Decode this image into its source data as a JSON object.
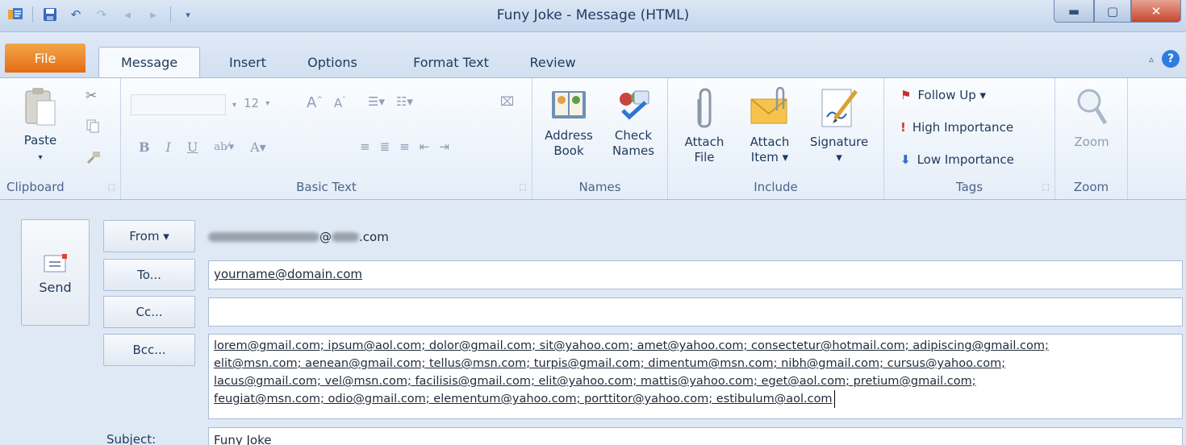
{
  "window": {
    "title": "Funy Joke  -  Message (HTML)",
    "quick_access": [
      "outlook-icon",
      "save-icon",
      "undo-icon",
      "redo-icon",
      "previous-icon",
      "next-icon",
      "customize-icon"
    ]
  },
  "tabs": [
    {
      "label": "File"
    },
    {
      "label": "Message"
    },
    {
      "label": "Insert"
    },
    {
      "label": "Options"
    },
    {
      "label": "Format Text"
    },
    {
      "label": "Review"
    }
  ],
  "ribbon": {
    "clipboard": {
      "label": "Clipboard",
      "paste": "Paste"
    },
    "basic_text": {
      "label": "Basic Text",
      "font_size": "12"
    },
    "names": {
      "label": "Names",
      "address_book": [
        "Address",
        "Book"
      ],
      "check_names": [
        "Check",
        "Names"
      ]
    },
    "include": {
      "label": "Include",
      "attach_file": [
        "Attach",
        "File"
      ],
      "attach_item": [
        "Attach",
        "Item ▾"
      ],
      "signature": [
        "Signature",
        "▾"
      ]
    },
    "tags": {
      "label": "Tags",
      "follow_up": "Follow Up ▾",
      "high_importance": "High Importance",
      "low_importance": "Low Importance"
    },
    "zoom": {
      "label": "Zoom",
      "zoom": "Zoom"
    }
  },
  "form": {
    "send": "Send",
    "from_button": "From ▾",
    "from_value_visible": "@",
    "from_value_suffix": ".com",
    "to_button": "To...",
    "to_value": "yourname@domain.com",
    "cc_button": "Cc...",
    "cc_value": "",
    "bcc_button": "Bcc...",
    "bcc_lines": [
      "lorem@gmail.com; ipsum@aol.com; dolor@gmail.com; sit@yahoo.com; amet@yahoo.com; consectetur@hotmail.com; adipiscing@gmail.com;",
      "elit@msn.com; aenean@gmail.com; tellus@msn.com; turpis@gmail.com; dimentum@msn.com; nibh@gmail.com; cursus@yahoo.com;",
      "lacus@gmail.com; vel@msn.com; facilisis@gmail.com; elit@yahoo.com; mattis@yahoo.com; eget@aol.com; pretium@gmail.com;",
      "feugiat@msn.com; odio@gmail.com; elementum@yahoo.com; porttitor@yahoo.com; estibulum@aol.com"
    ],
    "subject_label": "Subject:",
    "subject_value": "Funy Joke"
  },
  "colors": {
    "file_tab": "#e46c14",
    "ribbon_text": "#1e395b",
    "close_button": "#c7462d"
  }
}
